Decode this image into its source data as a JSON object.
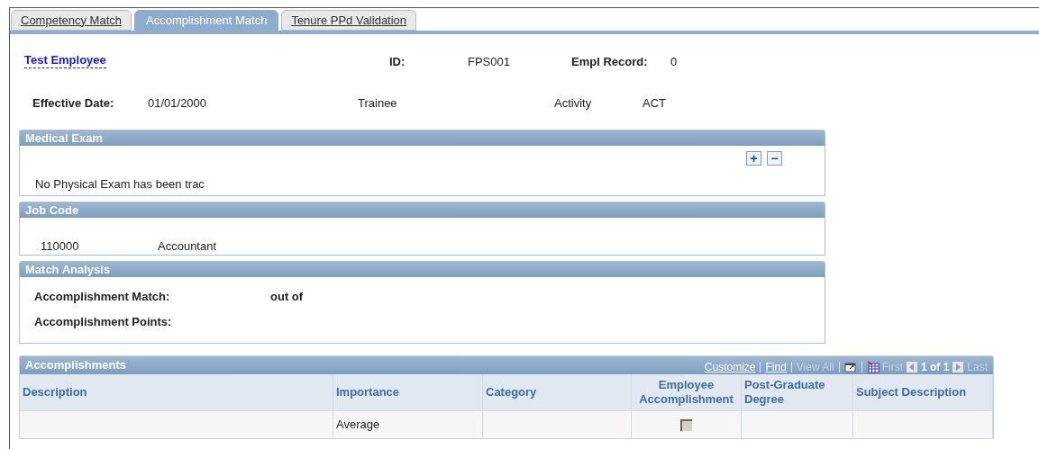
{
  "tabs": [
    {
      "label": "Competency Match",
      "selected": false
    },
    {
      "label": "Accomplishment Match",
      "selected": true
    },
    {
      "label": "Tenure PPd Validation",
      "selected": false
    }
  ],
  "header": {
    "employee_name": "Test Employee",
    "id_label": "ID:",
    "id_value": "FPS001",
    "empl_record_label": "Empl Record:",
    "empl_record_value": "0",
    "effective_date_label": "Effective Date:",
    "effective_date_value": "01/01/2000",
    "job_title": "Trainee",
    "activity_label": "Activity",
    "activity_value": "ACT"
  },
  "medical_exam": {
    "title": "Medical Exam",
    "add": "+",
    "remove": "−",
    "message": "No Physical Exam has been trac"
  },
  "job_code": {
    "title": "Job Code",
    "code": "110000",
    "description": "Accountant"
  },
  "match_analysis": {
    "title": "Match Analysis",
    "match_label": "Accomplishment Match:",
    "out_of": "out of",
    "points_label": "Accomplishment Points:"
  },
  "accomplishments": {
    "title": "Accomplishments",
    "toolbar": [
      {
        "kind": "link",
        "label": "Customize",
        "disabled": false
      },
      {
        "kind": "link",
        "label": "Find",
        "disabled": false
      },
      {
        "kind": "link",
        "label": "View All",
        "disabled": true
      },
      {
        "kind": "popout"
      },
      {
        "kind": "grid"
      },
      {
        "kind": "link",
        "label": "First",
        "disabled": true
      },
      {
        "kind": "prev"
      },
      {
        "kind": "text",
        "label": "1 of 1"
      },
      {
        "kind": "next"
      },
      {
        "kind": "link",
        "label": "Last",
        "disabled": true
      }
    ],
    "columns": [
      "Description",
      "Importance",
      "Category",
      "Employee Accomplishment",
      "Post-Graduate Degree",
      "Subject Description"
    ],
    "rows": [
      {
        "description": "",
        "importance": "Average",
        "category": "",
        "employee_accomplishment": {
          "checked": false,
          "disabled": true
        },
        "post_graduate_degree": "",
        "subject_description": ""
      }
    ]
  }
}
